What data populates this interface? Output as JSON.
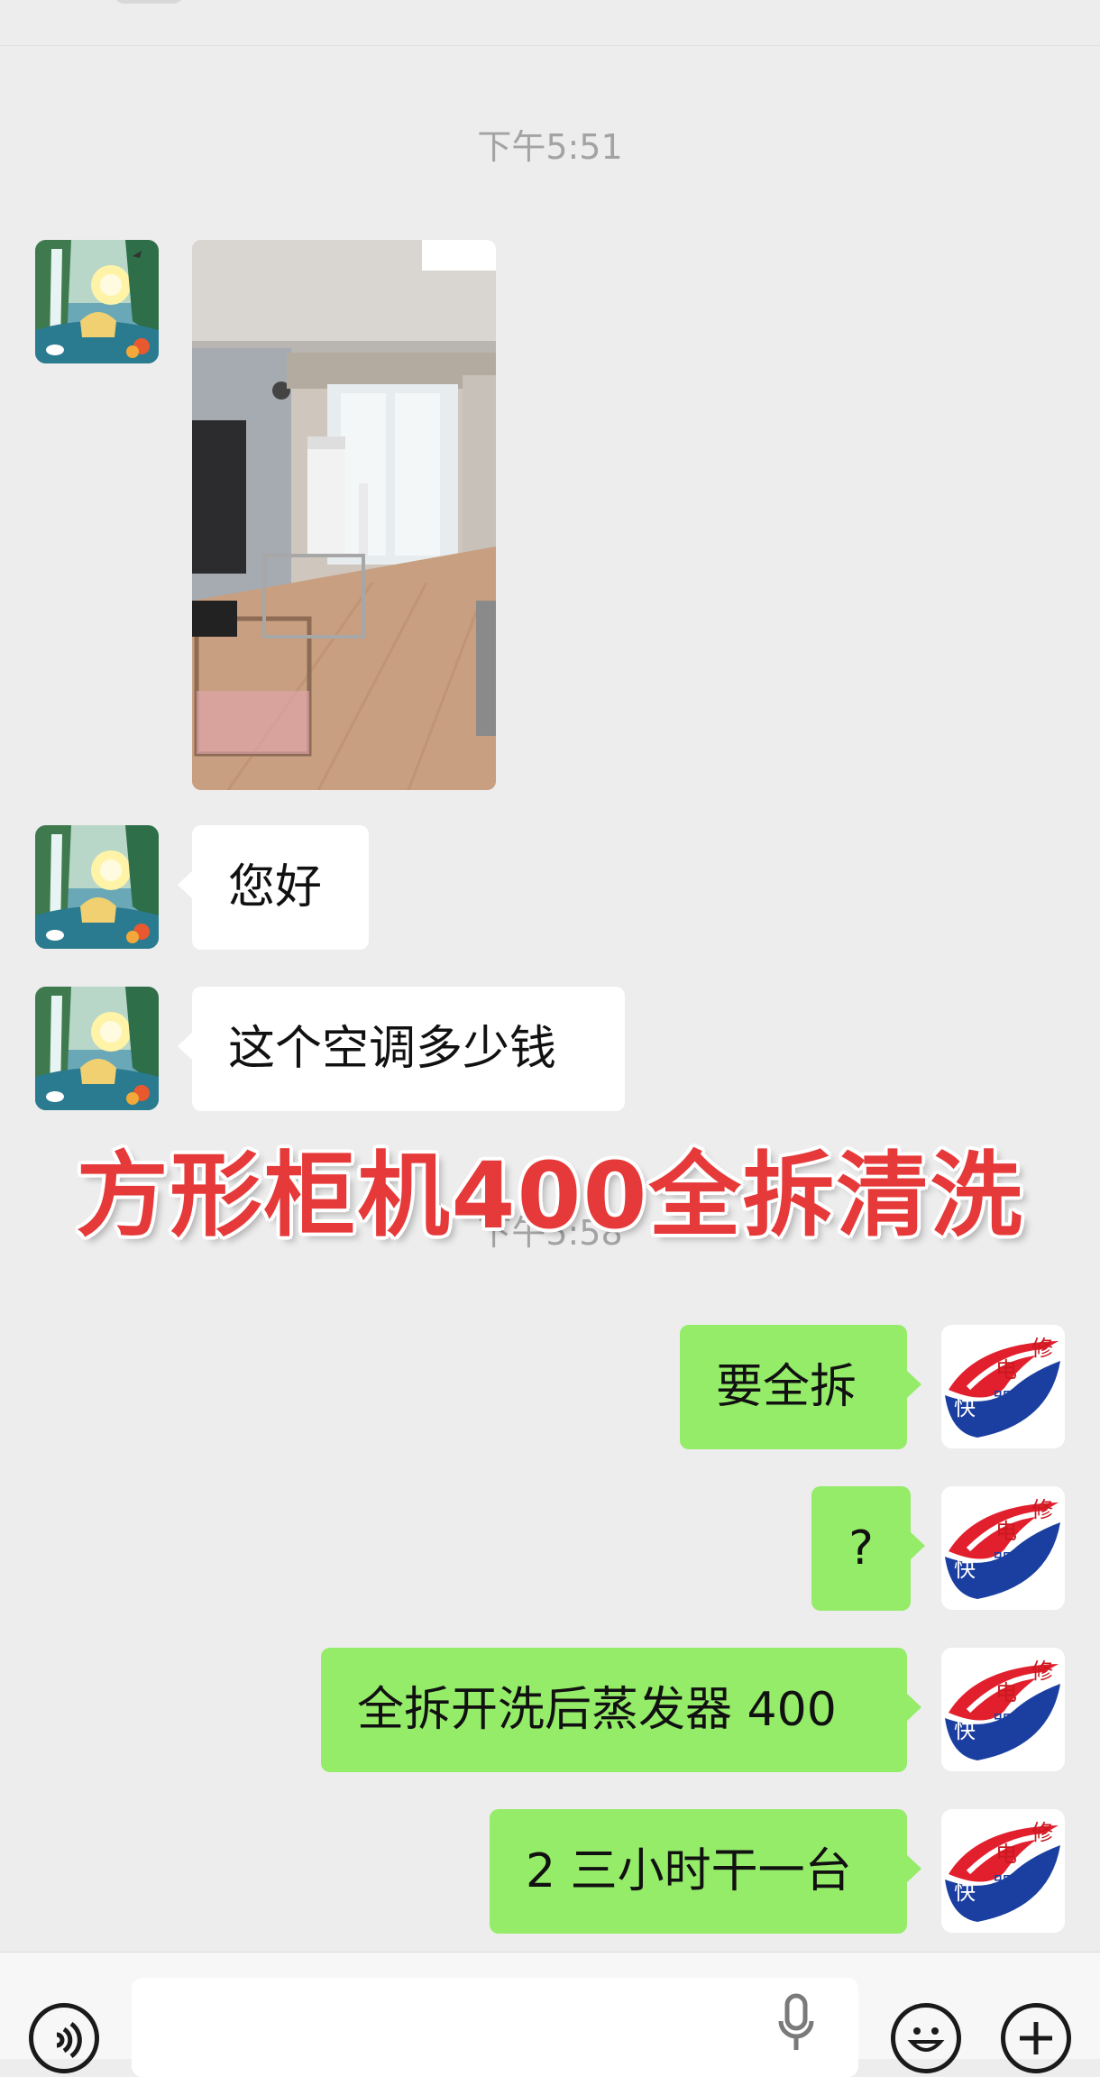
{
  "timestamps": {
    "first": "下午5:51",
    "second": "下午5:58"
  },
  "messages": {
    "in_1": "您好",
    "in_2": "这个空调多少钱",
    "out_1": "要全拆",
    "out_2": "?",
    "out_3": "全拆开洗后蒸发器 400",
    "out_4": "2 三小时干一台"
  },
  "overlay": {
    "caption": "方形柜机400全拆清洗"
  },
  "logo": {
    "chars": [
      "电",
      "修",
      "快",
      "器"
    ]
  },
  "icons": {
    "voice": "voice-mode-icon",
    "mic": "microphone-icon",
    "emoji": "emoji-icon",
    "plus": "plus-icon"
  },
  "colors": {
    "background": "#ededed",
    "outgoing_bubble": "#95ec69",
    "incoming_bubble": "#ffffff",
    "overlay_text": "#e63a3a"
  }
}
